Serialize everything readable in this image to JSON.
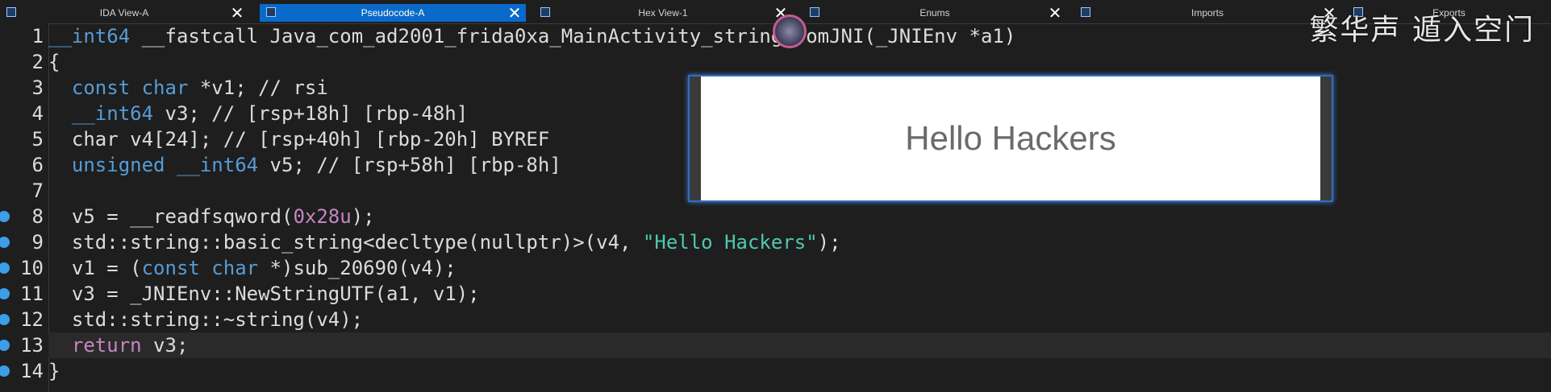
{
  "tabs": [
    {
      "label": "IDA View-A",
      "close": "✕"
    },
    {
      "label": "Pseudocode-A",
      "close": "✕"
    },
    {
      "label": "Hex View-1",
      "close": "✕"
    },
    {
      "label": "Enums",
      "close": "✕"
    },
    {
      "label": "Imports",
      "close": "✕"
    },
    {
      "label": "Exports",
      "close": ""
    }
  ],
  "overlay_title": "繁华声 遁入空门",
  "code_lines": [
    {
      "num": "1",
      "text": "__int64 __fastcall Java_com_ad2001_frida0xa_MainActivity_stringFromJNI(_JNIEnv *a1)",
      "breakpoint": false
    },
    {
      "num": "2",
      "text": "{",
      "breakpoint": false
    },
    {
      "num": "3",
      "text": "  const char *v1; // rsi",
      "breakpoint": false
    },
    {
      "num": "4",
      "text": "  __int64 v3; // [rsp+18h] [rbp-48h]",
      "breakpoint": false
    },
    {
      "num": "5",
      "text": "  char v4[24]; // [rsp+40h] [rbp-20h] BYREF",
      "breakpoint": false
    },
    {
      "num": "6",
      "text": "  unsigned __int64 v5; // [rsp+58h] [rbp-8h]",
      "breakpoint": false
    },
    {
      "num": "7",
      "text": "",
      "breakpoint": false
    },
    {
      "num": "8",
      "text": "  v5 = __readfsqword(0x28u);",
      "breakpoint": true
    },
    {
      "num": "9",
      "text": "  std::string::basic_string<decltype(nullptr)>(v4, \"Hello Hackers\");",
      "breakpoint": true
    },
    {
      "num": "10",
      "text": "  v1 = (const char *)sub_20690(v4);",
      "breakpoint": true
    },
    {
      "num": "11",
      "text": "  v3 = _JNIEnv::NewStringUTF(a1, v1);",
      "breakpoint": true
    },
    {
      "num": "12",
      "text": "  std::string::~string(v4);",
      "breakpoint": true
    },
    {
      "num": "13",
      "text": "  return v3;",
      "breakpoint": true
    },
    {
      "num": "14",
      "text": "}",
      "breakpoint": true
    }
  ],
  "popup": {
    "message": "Hello Hackers"
  },
  "colors": {
    "keyword": "#569cd6",
    "string": "#4ec9b0",
    "number": "#c586c0",
    "return": "#c586c0",
    "default": "#dcdcdc",
    "type_gray": "#9a9a9a"
  }
}
